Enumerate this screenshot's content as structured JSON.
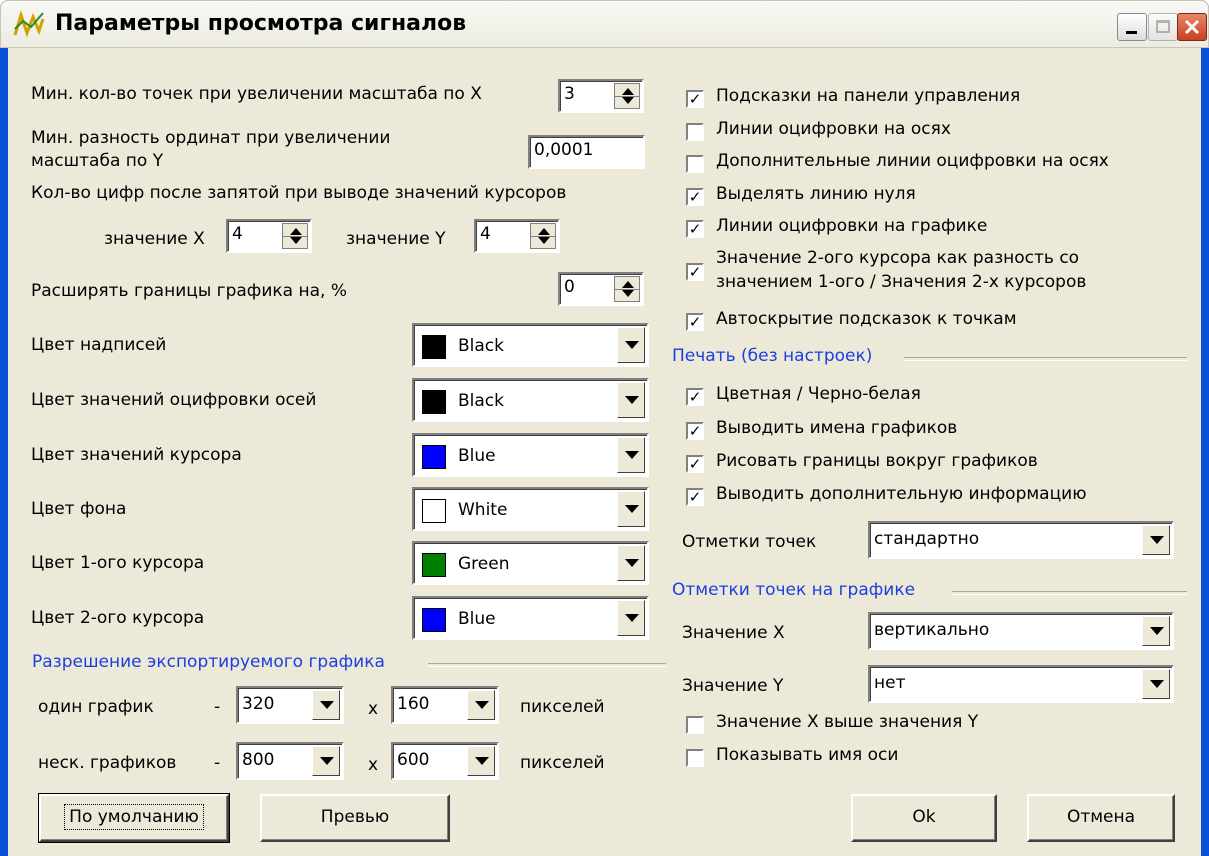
{
  "window": {
    "title": "Параметры просмотра сигналов"
  },
  "zoom": {
    "min_x_points_label": "Мин. кол-во точек при увеличении масштаба по X",
    "min_x_points_value": "3",
    "min_y_diff_label_line1": "Мин. разность ординат при увеличении",
    "min_y_diff_label_line2": "масштаба по Y",
    "min_y_diff_value": "0,0001",
    "decimals_label": "Кол-во цифр после запятой при выводе значений курсоров",
    "x_value_label": "значение X",
    "x_value": "4",
    "y_value_label": "значение Y",
    "y_value": "4",
    "expand_label": "Расширять границы графика на, %",
    "expand_value": "0"
  },
  "colors": [
    {
      "label": "Цвет надписей",
      "value": "Black",
      "hex": "#000000"
    },
    {
      "label": "Цвет значений оцифровки осей",
      "value": "Black",
      "hex": "#000000"
    },
    {
      "label": "Цвет значений курсора",
      "value": "Blue",
      "hex": "#0000ff"
    },
    {
      "label": "Цвет фона",
      "value": "White",
      "hex": "#ffffff"
    },
    {
      "label": "Цвет 1-ого курсора",
      "value": "Green",
      "hex": "#008000"
    },
    {
      "label": "Цвет 2-ого курсора",
      "value": "Blue",
      "hex": "#0000ff"
    }
  ],
  "export": {
    "section_label": "Разрешение экспортируемого графика",
    "single_label": "один график",
    "single_dash": "-",
    "single_w": "320",
    "single_x": "x",
    "single_h": "160",
    "single_unit": "пикселей",
    "multi_label": "неск. графиков",
    "multi_dash": "-",
    "multi_w": "800",
    "multi_x": "x",
    "multi_h": "600",
    "multi_unit": "пикселей"
  },
  "options": [
    {
      "label": "Подсказки на панели управления",
      "checked": true
    },
    {
      "label": "Линии оцифровки на осях",
      "checked": false
    },
    {
      "label": "Дополнительные линии оцифровки на осях",
      "checked": false
    },
    {
      "label": "Выделять линию нуля",
      "checked": true
    },
    {
      "label": "Линии оцифровки на графике",
      "checked": true
    },
    {
      "label_line1": "Значение 2-ого курсора как разность со",
      "label_line2": "значением 1-ого / Значения 2-х курсоров",
      "checked": true
    },
    {
      "label": "Автоскрытие подсказок к точкам",
      "checked": true
    }
  ],
  "print": {
    "section_label": "Печать (без настроек)",
    "options": [
      {
        "label": "Цветная / Черно-белая",
        "checked": true
      },
      {
        "label": "Выводить имена графиков",
        "checked": true
      },
      {
        "label": "Рисовать границы вокруг графиков",
        "checked": true
      },
      {
        "label": "Выводить дополнительную информацию",
        "checked": true
      }
    ],
    "marks_label": "Отметки точек",
    "marks_value": "стандартно"
  },
  "point_marks": {
    "section_label": "Отметки точек на графике",
    "x_label": "Значение X",
    "x_value": "вертикально",
    "y_label": "Значение Y",
    "y_value": "нет",
    "x_above_y_label": "Значение X выше значения Y",
    "x_above_y_checked": false,
    "show_axis_name_label": "Показывать имя оси",
    "show_axis_name_checked": false
  },
  "buttons": {
    "defaults": "По умолчанию",
    "preview": "Превью",
    "ok": "Ok",
    "cancel": "Отмена"
  }
}
